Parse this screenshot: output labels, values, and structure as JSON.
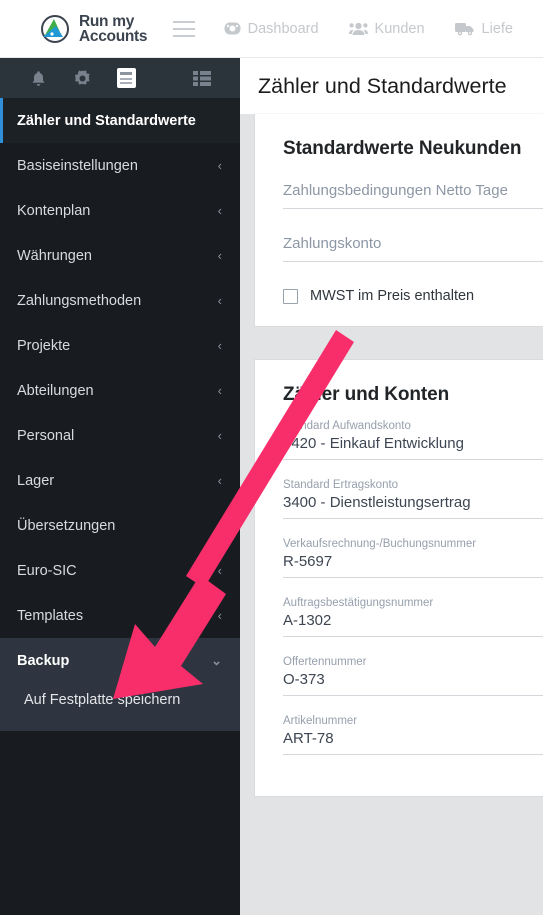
{
  "brand": {
    "name_line1": "Run my",
    "name_line2": "Accounts",
    "logo_icon": "runmyaccounts-logo-icon"
  },
  "topnav": {
    "menu_toggle_icon": "hamburger-icon",
    "items": [
      {
        "label": "Dashboard",
        "icon": "dashboard-gauge-icon"
      },
      {
        "label": "Kunden",
        "icon": "users-icon"
      },
      {
        "label": "Liefe",
        "icon": "delivery-truck-icon"
      }
    ]
  },
  "sidebar": {
    "iconbar": [
      {
        "name": "notifications-bell-icon"
      },
      {
        "name": "settings-gear-icon"
      },
      {
        "name": "documents-active-icon"
      },
      {
        "name": "grid-list-icon"
      }
    ],
    "items": [
      {
        "label": "Zähler und Standardwerte",
        "state": "active",
        "chevron": ""
      },
      {
        "label": "Basiseinstellungen",
        "state": "normal",
        "chevron": "‹"
      },
      {
        "label": "Kontenplan",
        "state": "normal",
        "chevron": "‹"
      },
      {
        "label": "Währungen",
        "state": "normal",
        "chevron": "‹"
      },
      {
        "label": "Zahlungsmethoden",
        "state": "normal",
        "chevron": "‹"
      },
      {
        "label": "Projekte",
        "state": "normal",
        "chevron": "‹"
      },
      {
        "label": "Abteilungen",
        "state": "normal",
        "chevron": "‹"
      },
      {
        "label": "Personal",
        "state": "normal",
        "chevron": "‹"
      },
      {
        "label": "Lager",
        "state": "normal",
        "chevron": "‹"
      },
      {
        "label": "Übersetzungen",
        "state": "normal",
        "chevron": ""
      },
      {
        "label": "Euro-SIC",
        "state": "normal",
        "chevron": "‹"
      },
      {
        "label": "Templates",
        "state": "normal",
        "chevron": "‹"
      },
      {
        "label": "Backup",
        "state": "open",
        "chevron": "⌄"
      }
    ],
    "submenu": [
      {
        "label": "Auf Festplatte speichern"
      }
    ]
  },
  "page": {
    "title": "Zähler und Standardwerte"
  },
  "cards": [
    {
      "heading": "Standardwerte Neukunden",
      "fields": [
        {
          "kind": "placeholder",
          "placeholder": "Zahlungsbedingungen Netto Tage",
          "value": ""
        },
        {
          "kind": "placeholder",
          "placeholder": "Zahlungskonto",
          "value": ""
        }
      ],
      "checkbox": {
        "label": "MWST im Preis enthalten",
        "checked": false
      }
    },
    {
      "heading": "Zähler und Konten",
      "fields": [
        {
          "kind": "filled",
          "label": "Standard Aufwandskonto",
          "value": "4420 - Einkauf Entwicklung"
        },
        {
          "kind": "filled",
          "label": "Standard Ertragskonto",
          "value": "3400 - Dienstleistungsertrag"
        },
        {
          "kind": "filled",
          "label": "Verkaufsrechnung-/Buchungsnummer",
          "value": "R-5697"
        },
        {
          "kind": "filled",
          "label": "Auftragsbestätigungsnummer",
          "value": "A-1302"
        },
        {
          "kind": "filled",
          "label": "Offertennummer",
          "value": "O-373"
        },
        {
          "kind": "filled",
          "label": "Artikelnummer",
          "value": "ART-78"
        }
      ]
    }
  ],
  "annotation": {
    "type": "arrow",
    "color": "#F82E6B",
    "points_from": "MWST im Preis enthalten checkbox area",
    "points_to": "Auf Festplatte speichern"
  },
  "colors": {
    "sidebar_bg": "#181c20",
    "sidebar_iconbar": "#2b333b",
    "sidebar_open_bg": "#2e3540",
    "accent_active": "#2f8fd8",
    "content_bg": "#e1e3e5",
    "annotation": "#F82E6B"
  }
}
